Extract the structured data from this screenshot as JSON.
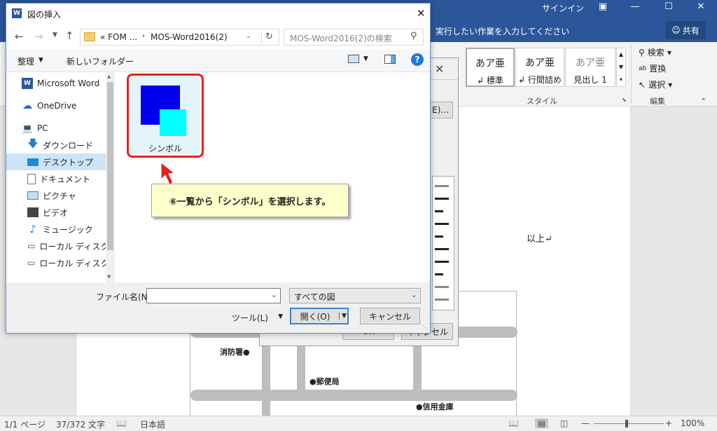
{
  "word": {
    "signin": "サインイン",
    "tell_me": "実行したい作業を入力してください",
    "share": "共有",
    "styles": [
      {
        "sample": "あア亜",
        "name": "↲ 標準"
      },
      {
        "sample": "あア亜",
        "name": "↲ 行間詰め"
      },
      {
        "sample": "あア亜",
        "name": "見出し 1"
      }
    ],
    "styles_group": "スタイル",
    "edit_group": "編集",
    "edit_items": [
      "検索",
      "置換",
      "選択"
    ],
    "doc_text": "以上↵",
    "map_labels": {
      "fire": "消防署●",
      "post": "●郵便局",
      "bank": "●信用金庫"
    }
  },
  "status": {
    "page": "1/1 ページ",
    "words": "37/372 文字",
    "lang": "日本語",
    "zoom": "100%"
  },
  "under_dialog": {
    "btn1": "E)...",
    "btn_ok": "OK",
    "btn_cancel": "キャンセル"
  },
  "dialog": {
    "title": "図の挿入",
    "address": {
      "crumb1": "«  FOM ...",
      "crumb2": "MOS-Word2016(2)"
    },
    "search_placeholder": "MOS-Word2016(2)の検索",
    "organize": "整理",
    "new_folder": "新しいフォルダー",
    "nav_items": [
      "Microsoft Word",
      "OneDrive",
      "PC",
      "ダウンロード",
      "デスクトップ",
      "ドキュメント",
      "ピクチャ",
      "ビデオ",
      "ミュージック",
      "ローカル ディスク (C",
      "ローカル ディスク (D"
    ],
    "file": {
      "name": "シンボル"
    },
    "filename_label": "ファイル名(N):",
    "filename_value": "",
    "filetype": "すべての図",
    "tools": "ツール(L)",
    "open": "開く(O)",
    "cancel": "キャンセル"
  },
  "callout": "⑥一覧から「シンボル」を選択します。",
  "colors": {
    "word_blue": "#2b579a",
    "accent": "#e2231a",
    "symbol_blue": "#0000ee",
    "symbol_cyan": "#00ffff"
  }
}
